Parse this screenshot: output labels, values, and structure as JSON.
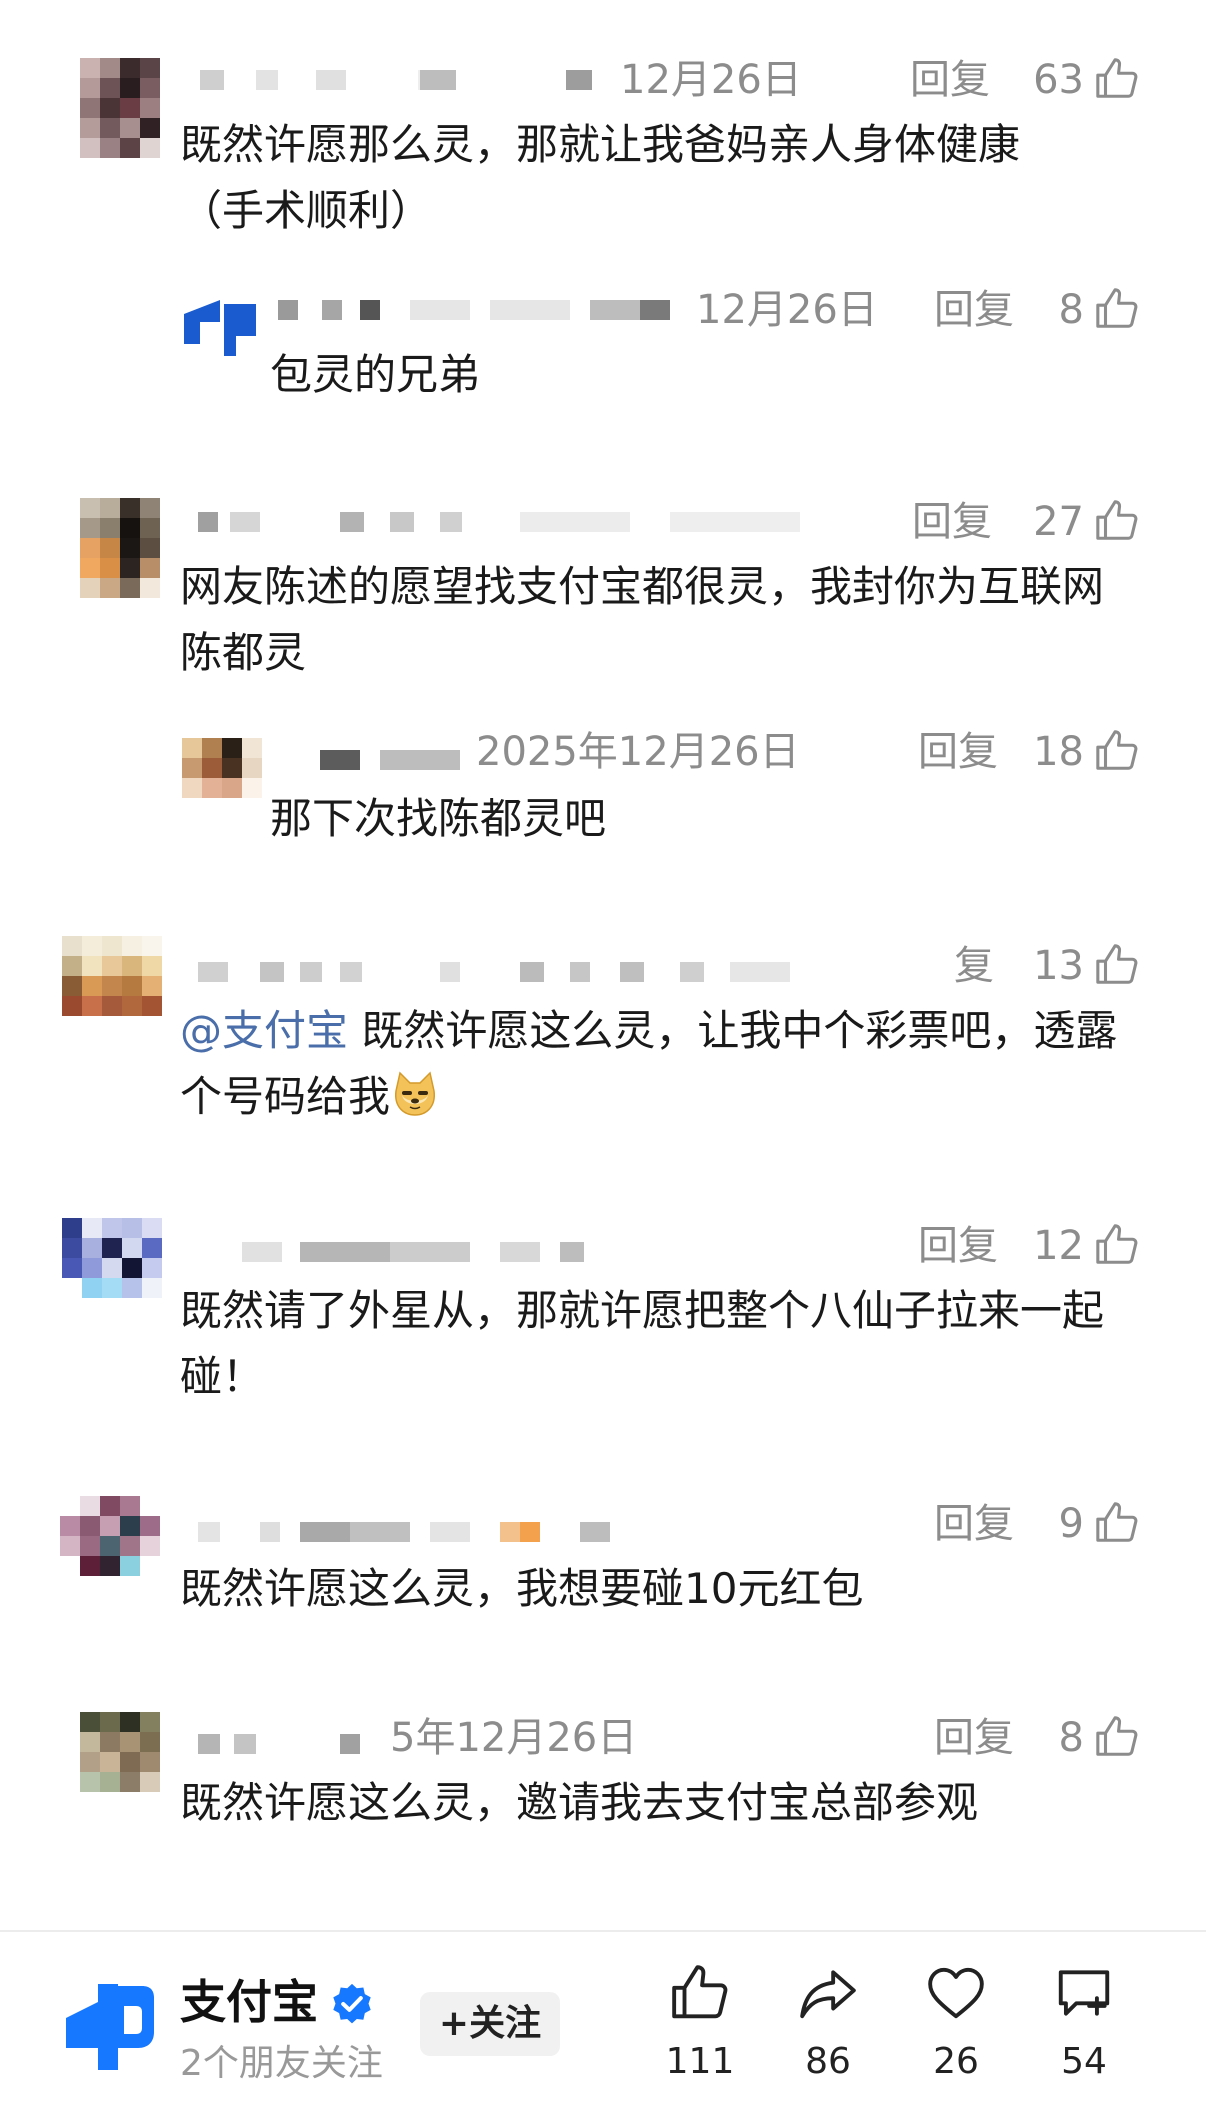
{
  "comments": [
    {
      "date": "12月26日",
      "reply_label": "回复",
      "likes": "63",
      "text": "既然许愿那么灵，那就让我爸妈亲人身体健康（手术顺利）"
    },
    {
      "date": "12月26日",
      "reply_label": "回复",
      "likes": "8",
      "text": "包灵的兄弟"
    },
    {
      "date": "",
      "reply_label": "回复",
      "likes": "27",
      "text": "网友陈述的愿望找支付宝都很灵，我封你为互联网陈都灵"
    },
    {
      "date": "2025年12月26日",
      "reply_label": "回复",
      "likes": "18",
      "text": "那下次找陈都灵吧"
    },
    {
      "date": "",
      "reply_label": "复",
      "likes": "13",
      "mention": "@支付宝",
      "text": " 既然许愿这么灵，让我中个彩票吧，透露个号码给我",
      "emoji": "doge-emoji"
    },
    {
      "date": "",
      "reply_label": "回复",
      "likes": "12",
      "text": "既然请了外星从，那就许愿把整个八仙子拉来一起碰！"
    },
    {
      "date": "",
      "reply_label": "回复",
      "likes": "9",
      "text": "既然许愿这么灵，我想要碰10元红包"
    },
    {
      "date": "5年12月26日",
      "reply_label": "回复",
      "likes": "8",
      "text": "既然许愿这么灵，邀请我去支付宝总部参观"
    }
  ],
  "footer": {
    "brand_name": "支付宝",
    "brand_sub": "2个朋友关注",
    "follow_label": "+关注",
    "like_count": "111",
    "share_count": "86",
    "favorite_count": "26",
    "comment_count": "54"
  },
  "colors": {
    "meta_gray": "#8c8c8c",
    "mention_blue": "#4a6ea9",
    "brand_blue": "#1677ff"
  }
}
